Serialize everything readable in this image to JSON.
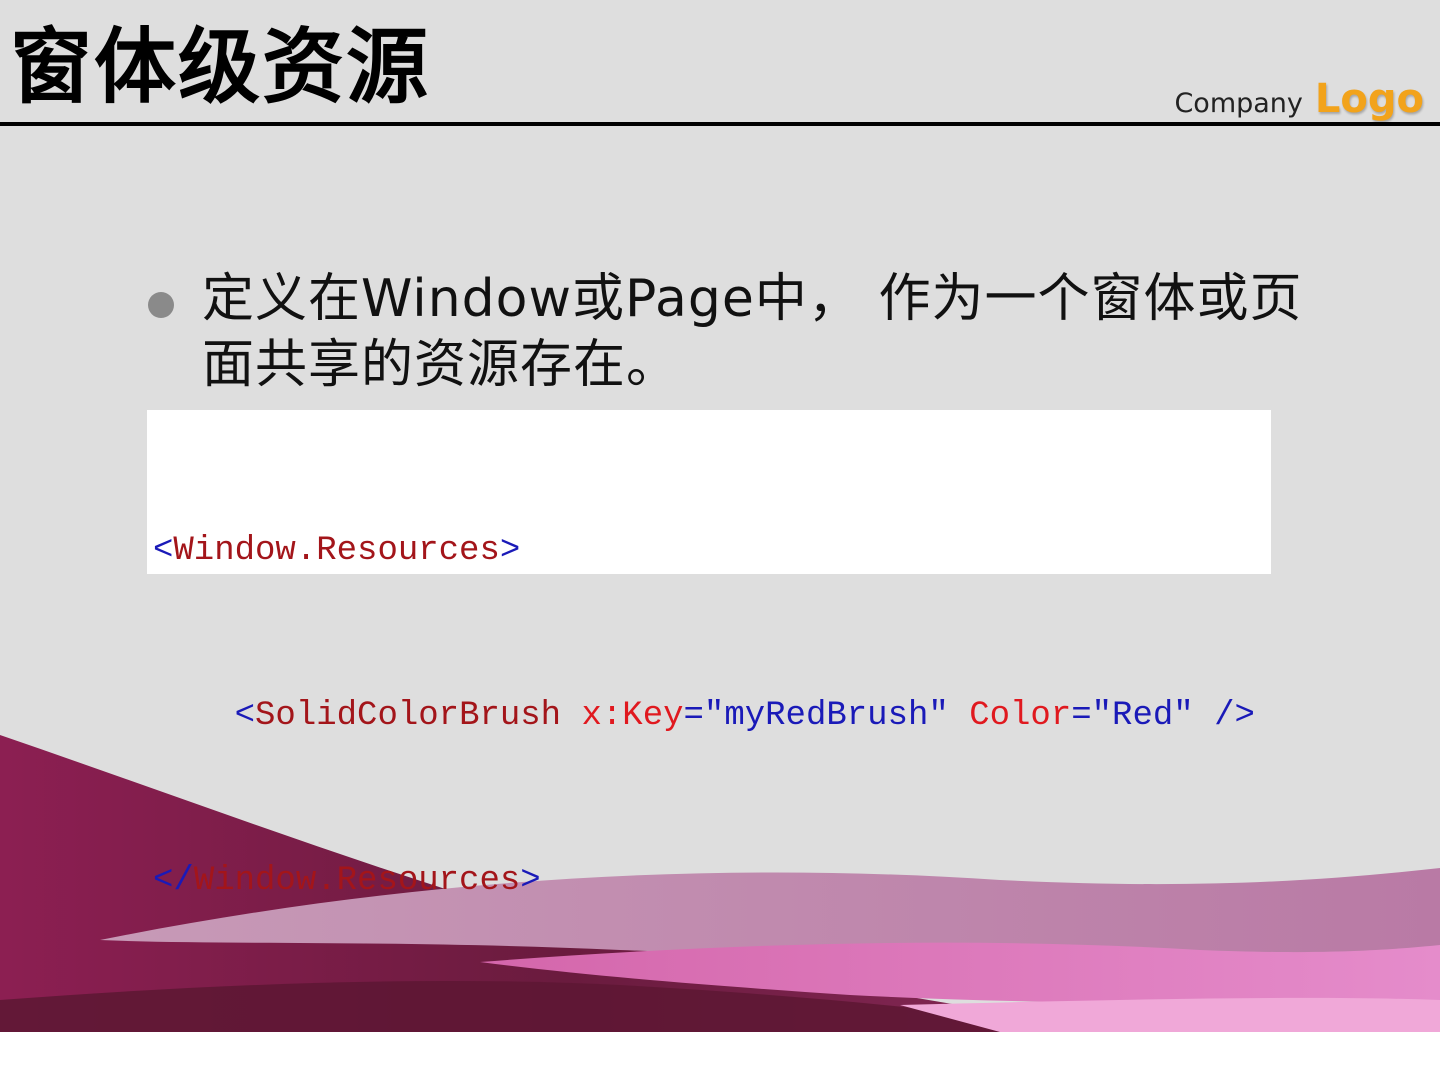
{
  "slide": {
    "title": "窗体级资源",
    "company_text": "Company",
    "logo_text": "Logo",
    "bullet": "定义在Window或Page中， 作为一个窗体或页面共享的资源存在。"
  },
  "code": {
    "line1": {
      "open": "<",
      "tag": "Window.Resources",
      "close": ">"
    },
    "line2": {
      "indent": "    ",
      "open": "<",
      "tag": "SolidColorBrush",
      "sp1": " ",
      "attr1": "x:Key",
      "eq1": "=\"",
      "val1": "myRedBrush",
      "q1": "\"",
      "sp2": " ",
      "attr2": "Color",
      "eq2": "=\"",
      "val2": "Red",
      "q2": "\"",
      "end": " />"
    },
    "line3": {
      "open": "</",
      "tag": "Window.Resources",
      "close": ">"
    }
  },
  "colors": {
    "accent_logo": "#f2a31b",
    "wave_dark": "#7a1a45",
    "wave_pink": "#e070b8",
    "code_blue": "#1a1ab8",
    "code_red": "#a3151a"
  }
}
